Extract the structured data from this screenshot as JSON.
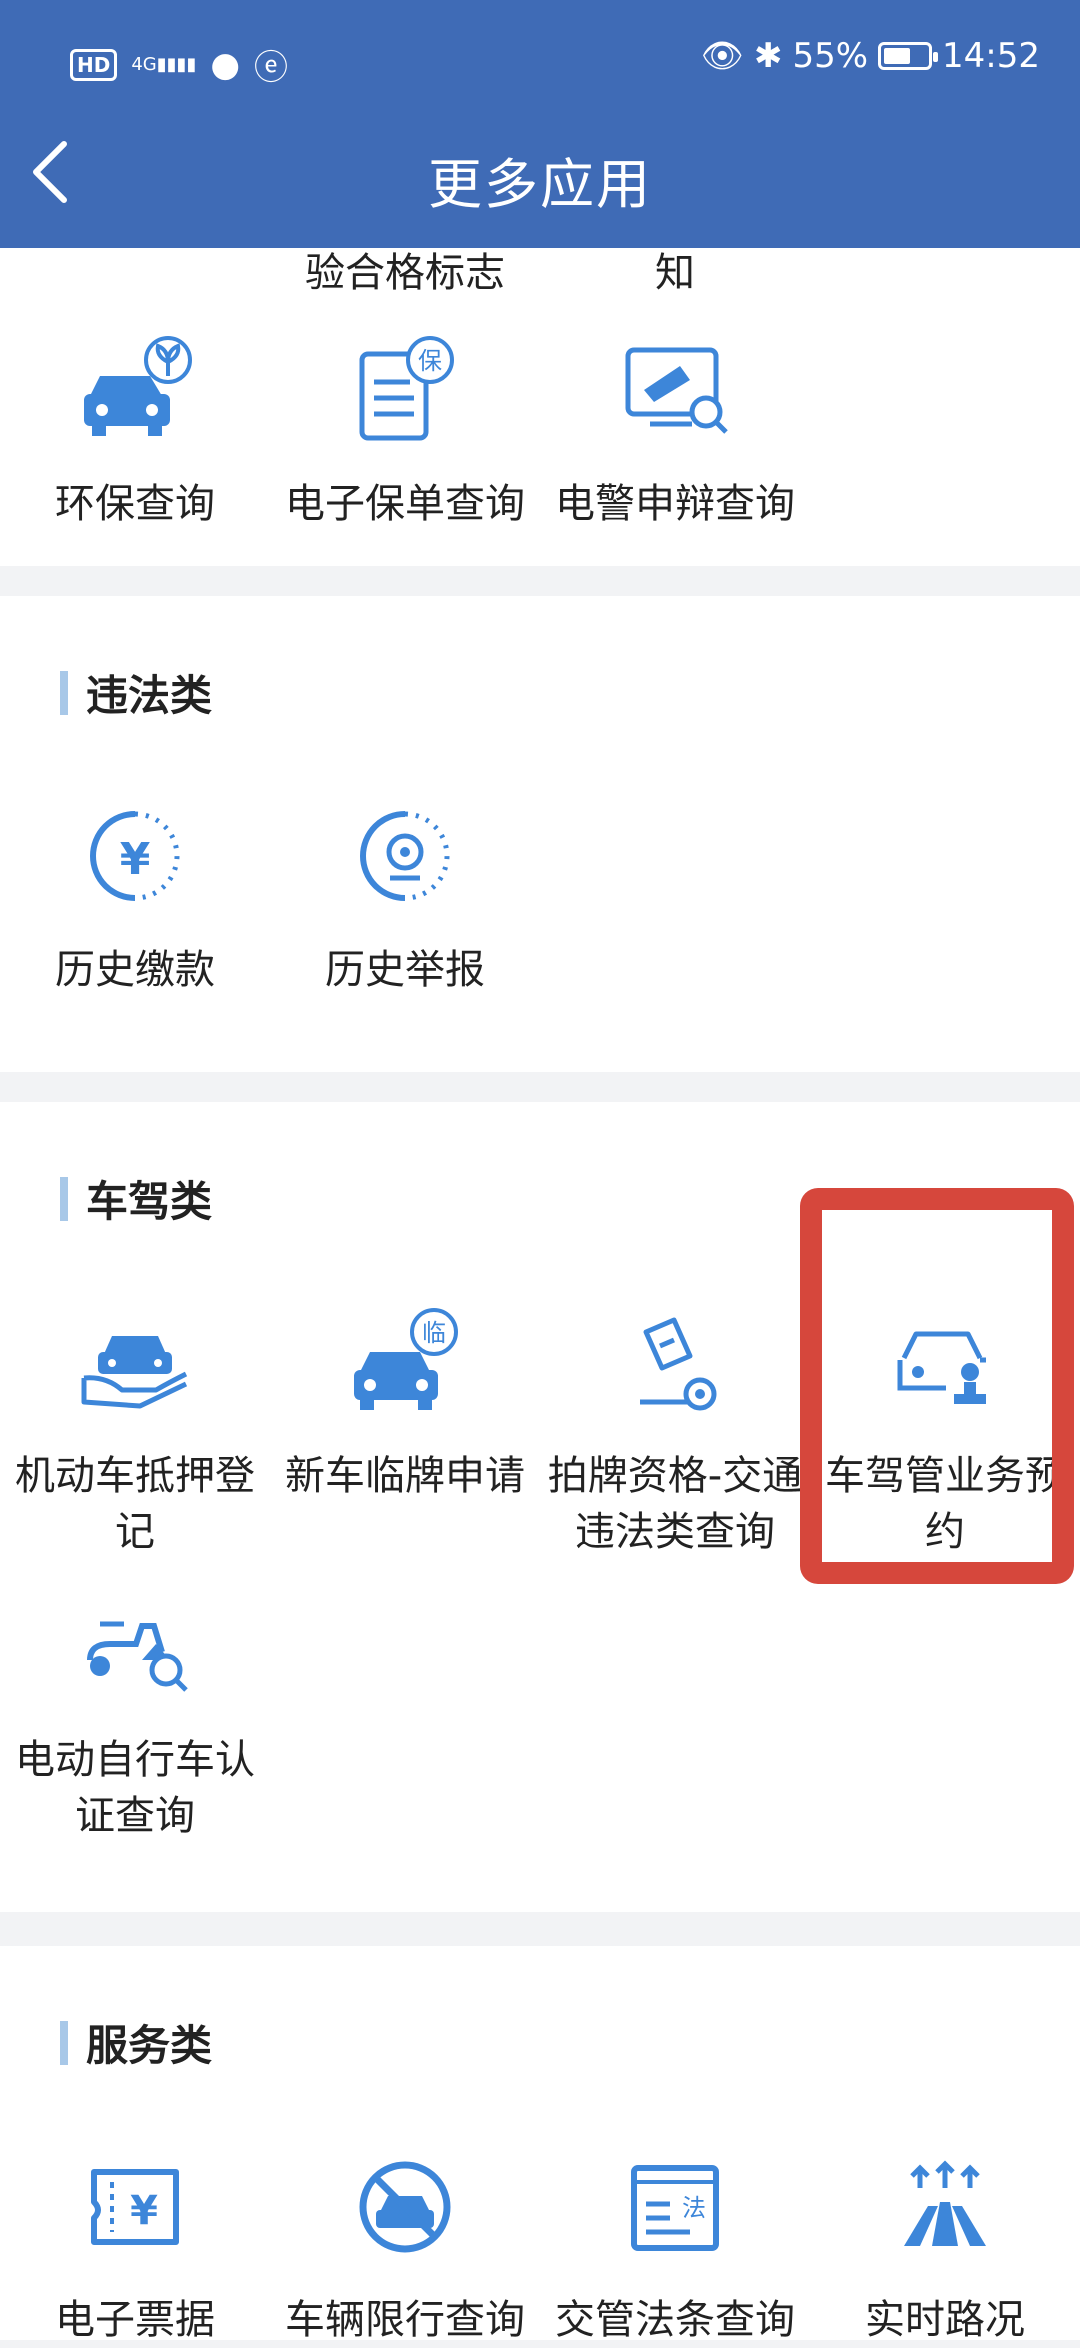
{
  "status_bar": {
    "left_icons": [
      "HD",
      "4G"
    ],
    "battery": "55%",
    "time": "14:52"
  },
  "header": {
    "title": "更多应用"
  },
  "sections": {
    "top": {
      "partial_labels": [
        "验合格标志",
        "知"
      ],
      "items": [
        {
          "label": "环保查询",
          "icon": "car-leaf-icon"
        },
        {
          "label": "电子保单查询",
          "icon": "insurance-doc-icon"
        },
        {
          "label": "电警申辩查询",
          "icon": "camera-search-icon"
        }
      ]
    },
    "violation": {
      "title": "违法类",
      "items": [
        {
          "label": "历史缴款",
          "icon": "yuan-circle-icon"
        },
        {
          "label": "历史举报",
          "icon": "camera-report-icon"
        }
      ]
    },
    "vehicle": {
      "title": "车驾类",
      "items": [
        {
          "label": "机动车抵押登记",
          "icon": "car-hand-icon"
        },
        {
          "label": "新车临牌申请",
          "icon": "car-temp-plate-icon"
        },
        {
          "label": "拍牌资格-交通违法类查询",
          "icon": "gavel-search-icon"
        },
        {
          "label": "车驾管业务预约",
          "icon": "car-stamp-icon"
        },
        {
          "label": "电动自行车认证查询",
          "icon": "scooter-search-icon"
        }
      ]
    },
    "service": {
      "title": "服务类",
      "items": [
        {
          "label": "电子票据",
          "icon": "receipt-icon"
        },
        {
          "label": "车辆限行查询",
          "icon": "no-car-icon"
        },
        {
          "label": "交管法条查询",
          "icon": "law-doc-icon"
        },
        {
          "label": "实时路况",
          "icon": "road-icon"
        }
      ]
    }
  },
  "colors": {
    "header": "#3f6bb6",
    "icon_blue": "#3d86d9",
    "highlight": "#d6473c"
  }
}
